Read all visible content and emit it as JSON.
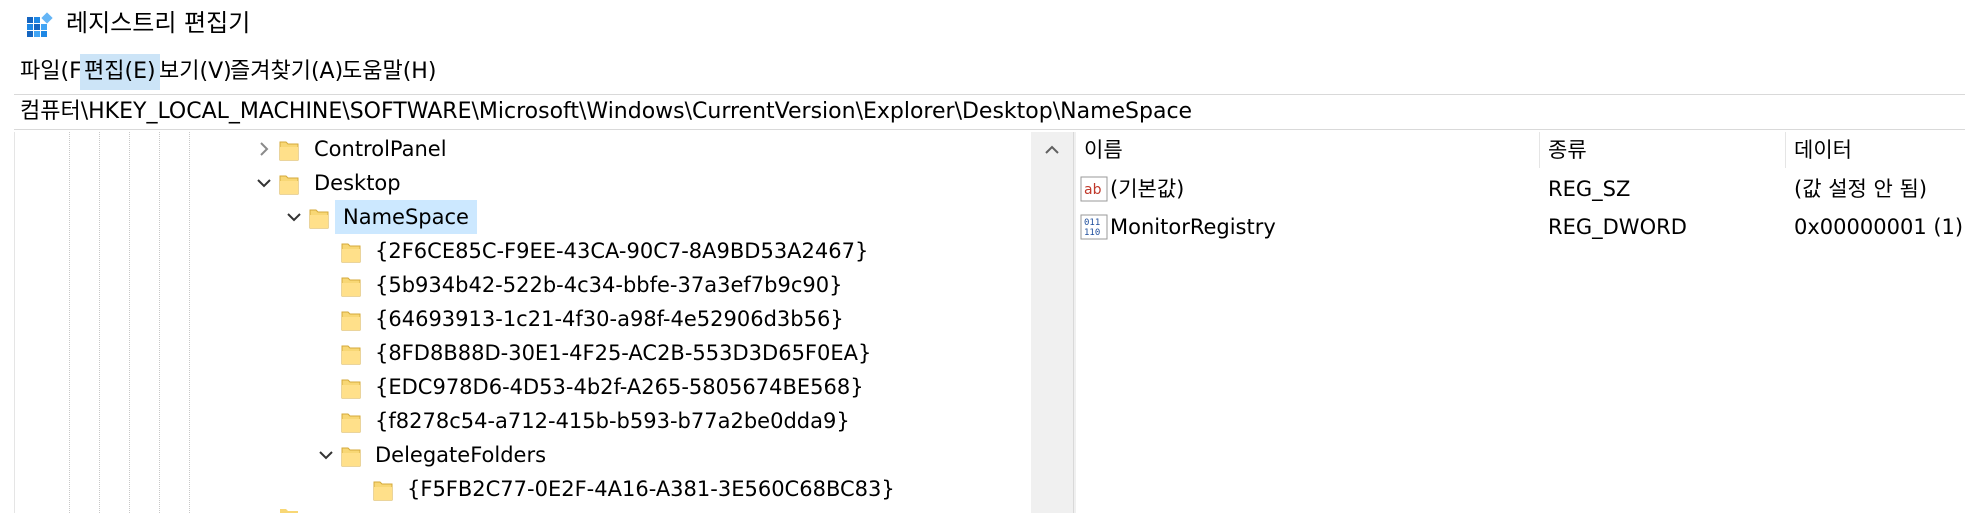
{
  "window": {
    "title": "레지스트리 편집기",
    "icon": "regedit-icon"
  },
  "menu": [
    "파일(F)",
    "편집(E)",
    "보기(V)",
    "즐겨찾기(A)",
    "도움말(H)"
  ],
  "menu_active_index": 1,
  "address": "컴퓨터\\HKEY_LOCAL_MACHINE\\SOFTWARE\\Microsoft\\Windows\\CurrentVersion\\Explorer\\Desktop\\NameSpace",
  "tree": {
    "items": [
      {
        "label": "ControlPanel",
        "state": "collapsed"
      },
      {
        "label": "Desktop",
        "state": "expanded"
      },
      {
        "label": "NameSpace",
        "state": "expanded",
        "selected": true
      },
      {
        "label": "{2F6CE85C-F9EE-43CA-90C7-8A9BD53A2467}",
        "state": "leaf"
      },
      {
        "label": "{5b934b42-522b-4c34-bbfe-37a3ef7b9c90}",
        "state": "leaf"
      },
      {
        "label": "{64693913-1c21-4f30-a98f-4e52906d3b56}",
        "state": "leaf"
      },
      {
        "label": "{8FD8B88D-30E1-4F25-AC2B-553D3D65F0EA}",
        "state": "leaf"
      },
      {
        "label": "{EDC978D6-4D53-4b2f-A265-5805674BE568}",
        "state": "leaf"
      },
      {
        "label": "{f8278c54-a712-415b-b593-b77a2be0dda9}",
        "state": "leaf"
      },
      {
        "label": "DelegateFolders",
        "state": "expanded"
      },
      {
        "label": "{F5FB2C77-0E2F-4A16-A381-3E560C68BC83}",
        "state": "leaf"
      }
    ]
  },
  "list": {
    "columns": [
      "이름",
      "종류",
      "데이터"
    ],
    "rows": [
      {
        "icon": "string-value-icon",
        "name": "(기본값)",
        "type": "REG_SZ",
        "data": "(값 설정 안 됨)"
      },
      {
        "icon": "binary-value-icon",
        "name": "MonitorRegistry",
        "type": "REG_DWORD",
        "data": "0x00000001 (1)"
      }
    ]
  },
  "colors": {
    "selection": "#cce8ff",
    "menu_active": "#cce4f7",
    "folder": "#f8d775",
    "string_icon": "#c0392b",
    "binary_icon": "#1f4e9c"
  }
}
